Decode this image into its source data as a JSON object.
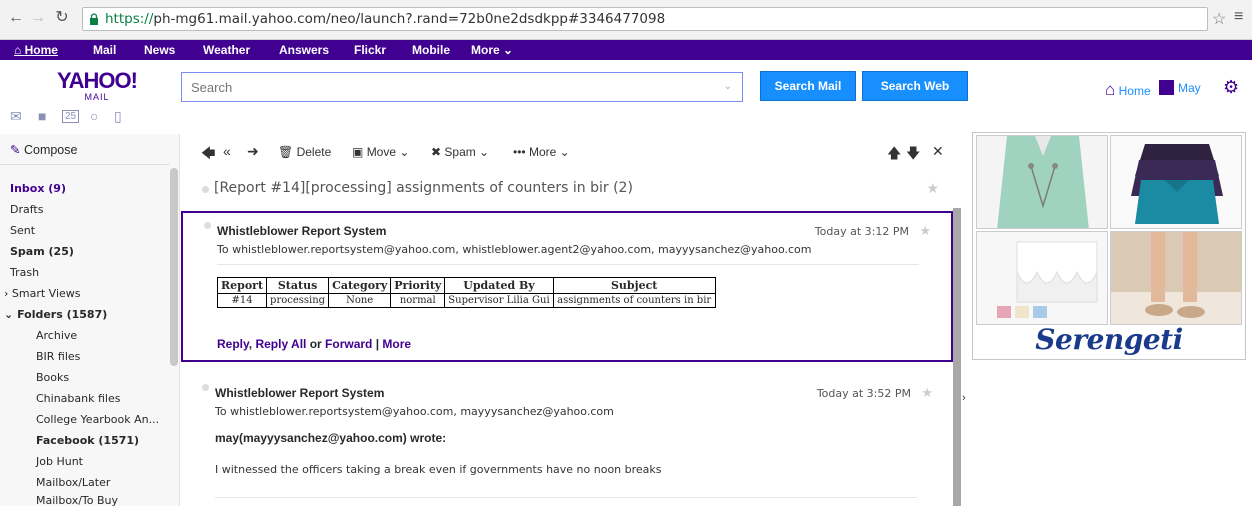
{
  "browser": {
    "url_scheme": "https://",
    "url_rest": "ph-mg61.mail.yahoo.com/neo/launch?.rand=72b0ne2dsdkpp#3346477098"
  },
  "topnav": {
    "items": [
      "Home",
      "Mail",
      "News",
      "Weather",
      "Answers",
      "Flickr",
      "Mobile",
      "More ⌄"
    ]
  },
  "header": {
    "logo_main": "YAHOO!",
    "logo_sub": "MAIL",
    "search_placeholder": "Search",
    "search_mail_label": "Search Mail",
    "search_web_label": "Search Web",
    "home_label": "Home",
    "user_label": "May"
  },
  "sidebar": {
    "compose_label": "Compose",
    "folders": [
      {
        "label": "Inbox (9)"
      },
      {
        "label": "Drafts"
      },
      {
        "label": "Sent"
      },
      {
        "label": "Spam (25)"
      },
      {
        "label": "Trash"
      },
      {
        "label": "Smart Views"
      },
      {
        "label": "Folders (1587)"
      },
      {
        "label": "Archive"
      },
      {
        "label": "BIR files"
      },
      {
        "label": "Books"
      },
      {
        "label": "Chinabank files"
      },
      {
        "label": "College Yearbook An..."
      },
      {
        "label": "Facebook (1571)"
      },
      {
        "label": "Job Hunt"
      },
      {
        "label": "Mailbox/Later"
      },
      {
        "label": "Mailbox/To Buy"
      }
    ]
  },
  "toolbar": {
    "delete_label": "Delete",
    "move_label": "Move ⌄",
    "spam_label": "Spam ⌄",
    "more_label": "More ⌄"
  },
  "thread": {
    "subject": "[Report #14][processing] assignments of counters in bir (2)"
  },
  "messages": [
    {
      "from": "Whistleblower Report System",
      "to": "To  whistleblower.reportsystem@yahoo.com, whistleblower.agent2@yahoo.com, mayyysanchez@yahoo.com",
      "date": "Today at 3:12 PM",
      "table": {
        "headers": [
          "Report",
          "Status",
          "Category",
          "Priority",
          "Updated By",
          "Subject"
        ],
        "row": [
          "#14",
          "processing",
          "None",
          "normal",
          "Supervisor Lilia Gui",
          "assignments of counters in bir"
        ]
      },
      "actions": {
        "reply": "Reply",
        "comma": ", ",
        "reply_all": "Reply All",
        "or": " or ",
        "forward": "Forward",
        "pipe": " | ",
        "more": "More"
      }
    },
    {
      "from": "Whistleblower Report System",
      "to": "To  whistleblower.reportsystem@yahoo.com, mayyysanchez@yahoo.com",
      "date": "Today at 3:52 PM",
      "quote_author": "may(mayyysanchez@yahoo.com) wrote:",
      "quote_body": "I witnessed the officers taking a break even if governments have no noon breaks"
    }
  ],
  "ad": {
    "brand": "Serengeti",
    "choices": "ⓘ✕",
    "colors": {
      "brand": "#1a3b8c",
      "accent": "#400090",
      "button": "#188fff"
    }
  }
}
